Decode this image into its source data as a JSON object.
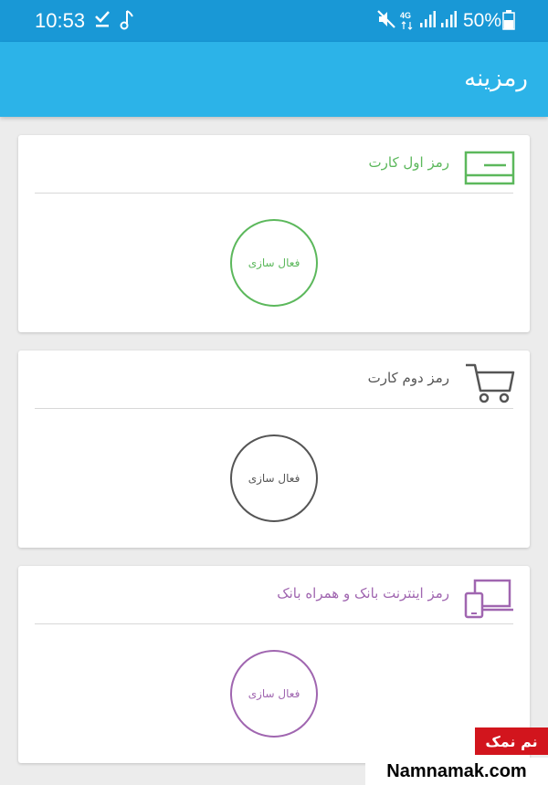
{
  "status_bar": {
    "time": "10:53",
    "battery": "50%",
    "network": "4G",
    "icons": [
      "download-done-icon",
      "music-note-icon",
      "mute-icon",
      "network-4g-icon",
      "signal-icon",
      "signal-icon",
      "battery-icon"
    ]
  },
  "app_bar": {
    "title": "رمزینه",
    "background": "#2cb3e8"
  },
  "cards": [
    {
      "title": "رمز اول کارت",
      "button": "فعال سازی",
      "color": "#5cb85c",
      "icon": "card-icon"
    },
    {
      "title": "رمز دوم کارت",
      "button": "فعال سازی",
      "color": "#555555",
      "icon": "shopping-cart-icon"
    },
    {
      "title": "رمز اینترنت بانک و همراه بانک",
      "button": "فعال سازی",
      "color": "#a066b0",
      "icon": "devices-icon"
    }
  ],
  "watermark": {
    "badge": "نم نمک",
    "site": "Namnamak.com"
  }
}
